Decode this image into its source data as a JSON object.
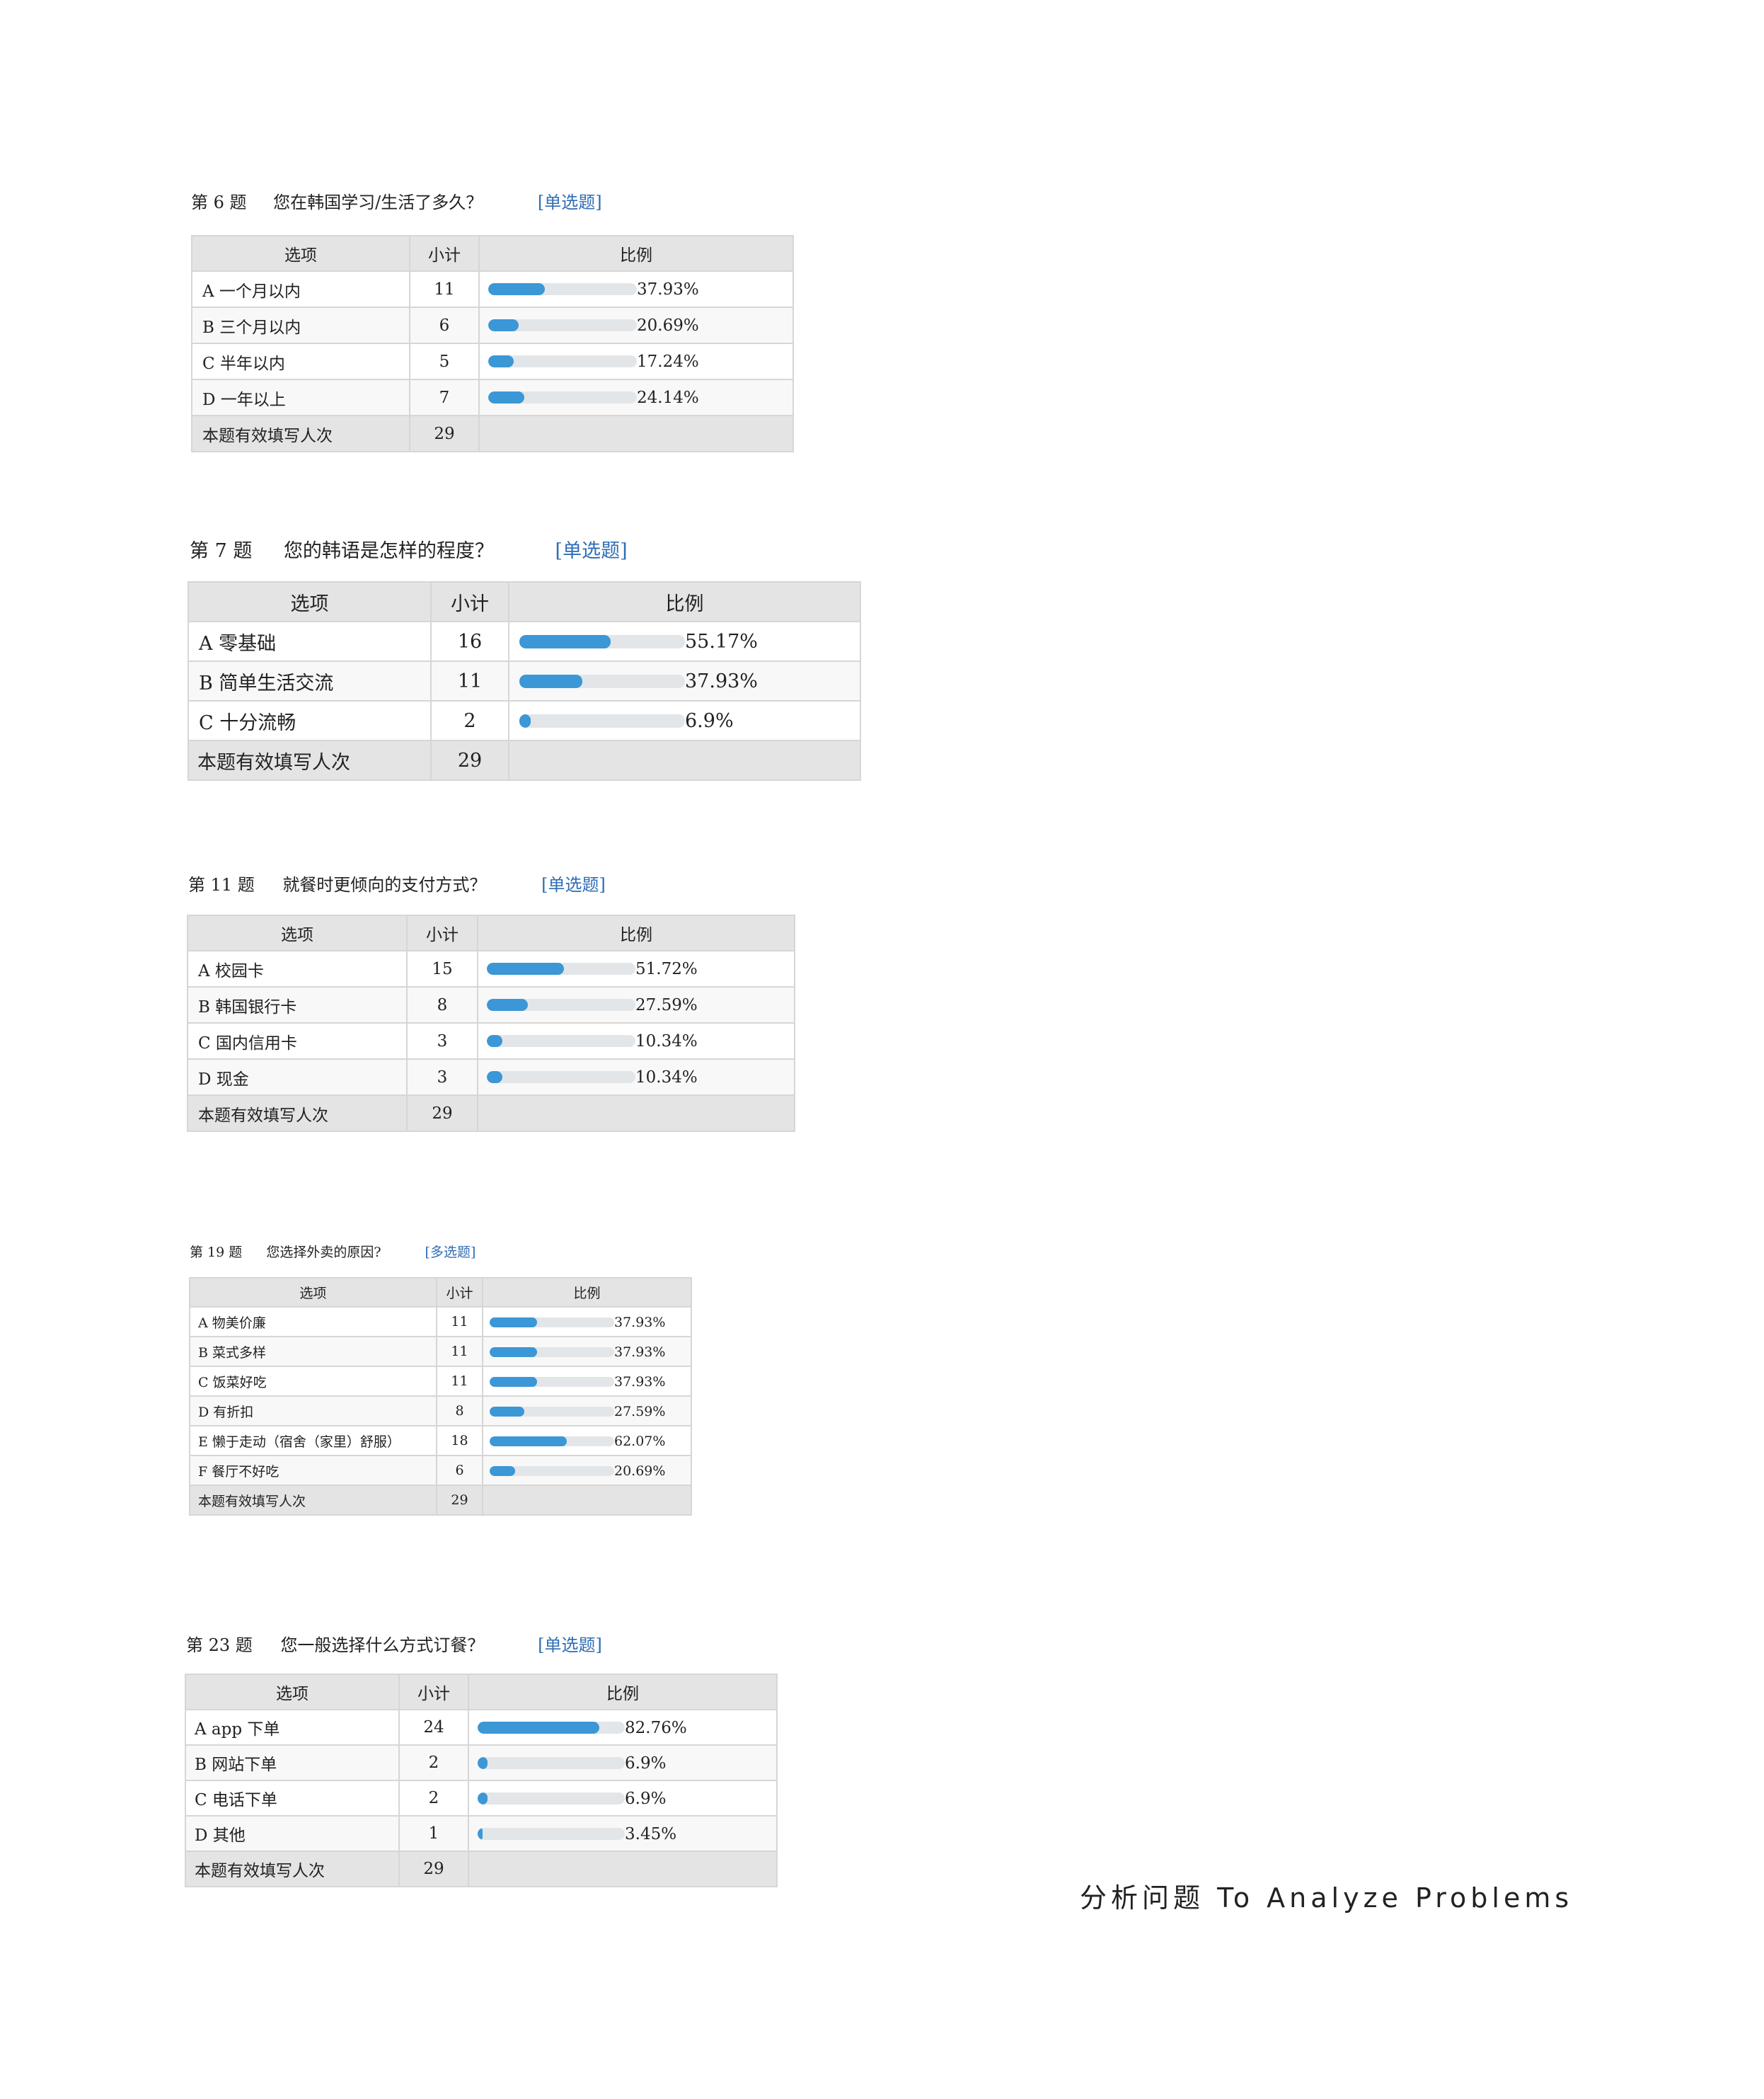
{
  "questions": [
    {
      "id": "q6",
      "number": "第 6 题",
      "text": "您在韩国学习/生活了多久？",
      "type": "[单选题]",
      "header": {
        "option": "选项",
        "count": "小计",
        "ratio": "比例"
      },
      "rows": [
        {
          "option": "A  一个月以内",
          "count": "11",
          "percent": "37.93%",
          "value": 37.93
        },
        {
          "option": "B  三个月以内",
          "count": "6",
          "percent": "20.69%",
          "value": 20.69
        },
        {
          "option": "C  半年以内",
          "count": "5",
          "percent": "17.24%",
          "value": 17.24
        },
        {
          "option": "D  一年以上",
          "count": "7",
          "percent": "24.14%",
          "value": 24.14
        }
      ],
      "total": {
        "label": "本题有效填写人次",
        "count": "29"
      }
    },
    {
      "id": "q7",
      "number": "第 7 题",
      "text": "您的韩语是怎样的程度？",
      "type": "[单选题]",
      "header": {
        "option": "选项",
        "count": "小计",
        "ratio": "比例"
      },
      "rows": [
        {
          "option": "A  零基础",
          "count": "16",
          "percent": "55.17%",
          "value": 55.17
        },
        {
          "option": "B  简单生活交流",
          "count": "11",
          "percent": "37.93%",
          "value": 37.93
        },
        {
          "option": "C  十分流畅",
          "count": "2",
          "percent": "6.9%",
          "value": 6.9
        }
      ],
      "total": {
        "label": "本题有效填写人次",
        "count": "29"
      }
    },
    {
      "id": "q11",
      "number": "第 11 题",
      "text": "就餐时更倾向的支付方式？",
      "type": "[单选题]",
      "header": {
        "option": "选项",
        "count": "小计",
        "ratio": "比例"
      },
      "rows": [
        {
          "option": "A  校园卡",
          "count": "15",
          "percent": "51.72%",
          "value": 51.72
        },
        {
          "option": "B    韩国银行卡",
          "count": "8",
          "percent": "27.59%",
          "value": 27.59
        },
        {
          "option": "C    国内信用卡",
          "count": "3",
          "percent": "10.34%",
          "value": 10.34
        },
        {
          "option": "D    现金",
          "count": "3",
          "percent": "10.34%",
          "value": 10.34
        }
      ],
      "total": {
        "label": "本题有效填写人次",
        "count": "29"
      }
    },
    {
      "id": "q19",
      "number": "第 19 题",
      "text": "您选择外卖的原因?",
      "type": "[多选题]",
      "header": {
        "option": "选项",
        "count": "小计",
        "ratio": "比例"
      },
      "rows": [
        {
          "option": "A  物美价廉",
          "count": "11",
          "percent": "37.93%",
          "value": 37.93
        },
        {
          "option": "B  菜式多样",
          "count": "11",
          "percent": "37.93%",
          "value": 37.93
        },
        {
          "option": "C  饭菜好吃",
          "count": "11",
          "percent": "37.93%",
          "value": 37.93
        },
        {
          "option": "D  有折扣",
          "count": "8",
          "percent": "27.59%",
          "value": 27.59
        },
        {
          "option": "E  懒于走动（宿舍（家里）舒服）",
          "count": "18",
          "percent": "62.07%",
          "value": 62.07
        },
        {
          "option": "F  餐厅不好吃",
          "count": "6",
          "percent": "20.69%",
          "value": 20.69
        }
      ],
      "total": {
        "label": "本题有效填写人次",
        "count": "29"
      }
    },
    {
      "id": "q23",
      "number": "第 23 题",
      "text": "您一般选择什么方式订餐？",
      "type": "[单选题]",
      "header": {
        "option": "选项",
        "count": "小计",
        "ratio": "比例"
      },
      "rows": [
        {
          "option": "A app 下单",
          "count": "24",
          "percent": "82.76%",
          "value": 82.76
        },
        {
          "option": "B  网站下单",
          "count": "2",
          "percent": "6.9%",
          "value": 6.9
        },
        {
          "option": "C  电话下单",
          "count": "2",
          "percent": "6.9%",
          "value": 6.9
        },
        {
          "option": "D  其他",
          "count": "1",
          "percent": "3.45%",
          "value": 3.45
        }
      ],
      "total": {
        "label": "本题有效填写人次",
        "count": "29"
      }
    }
  ],
  "footer": {
    "text": "分析问题 To Analyze Problems"
  },
  "colors": {
    "bar_fill": "#3b97d6",
    "bar_track": "#e3e6e9",
    "question_type": "#2f6db5",
    "header_bg": "#e4e4e4"
  }
}
